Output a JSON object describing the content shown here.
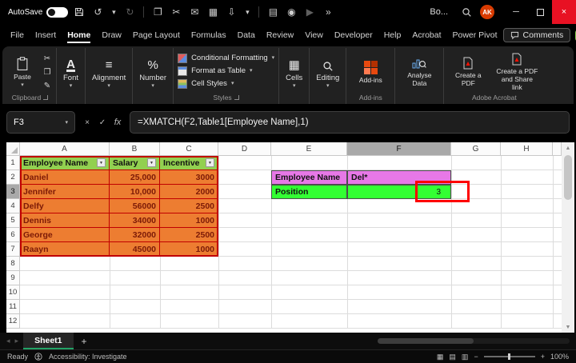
{
  "colors": {
    "accent_green": "#21a366",
    "table_header_fill": "#92d050",
    "table_body_fill": "#ed7d31",
    "table_border_red": "#c00000",
    "table_text_red": "#7c1a07",
    "lookup_magenta_fill": "#e778e7",
    "lookup_green_fill": "#33ff33",
    "annotation_red": "#fe0000",
    "close_button_red": "#e81123",
    "avatar_red": "#d83b01",
    "selected_header_gray": "#a9a9a9"
  },
  "title_bar": {
    "autosave_label": "AutoSave",
    "workbook_name": "Bo...",
    "avatar_initials": "AK"
  },
  "ribbon_tabs": {
    "items": [
      "File",
      "Insert",
      "Home",
      "Draw",
      "Page Layout",
      "Formulas",
      "Data",
      "Review",
      "View",
      "Developer",
      "Help",
      "Acrobat",
      "Power Pivot"
    ],
    "active": "Home",
    "comments_label": "Comments"
  },
  "ribbon": {
    "paste_label": "Paste",
    "clipboard_group_label": "Clipboard",
    "font_label": "Font",
    "alignment_label": "Alignment",
    "number_label": "Number",
    "conditional_formatting_label": "Conditional Formatting",
    "format_as_table_label": "Format as Table",
    "cell_styles_label": "Cell Styles",
    "styles_group_label": "Styles",
    "cells_label": "Cells",
    "editing_label": "Editing",
    "addins_label": "Add-ins",
    "addins_group_label": "Add-ins",
    "analyse_data_label": "Analyse Data",
    "create_pdf_label": "Create a PDF",
    "create_pdf_share_label": "Create a PDF and Share link",
    "adobe_group_label": "Adobe Acrobat"
  },
  "formula_bar": {
    "name_box_value": "F3",
    "cancel_label": "×",
    "enter_label": "✓",
    "fx_label": "fx",
    "formula": "=XMATCH(F2,Table1[Employee Name],1)"
  },
  "grid": {
    "column_headers": [
      "A",
      "B",
      "C",
      "D",
      "E",
      "F",
      "G",
      "H"
    ],
    "row_headers": [
      "1",
      "2",
      "3",
      "4",
      "5",
      "6",
      "7",
      "8",
      "9",
      "10",
      "11",
      "12"
    ],
    "selected_column": "F",
    "selected_row": "3",
    "employee_table": {
      "headers": [
        "Employee Name",
        "Salary",
        "Incentive"
      ],
      "rows": [
        [
          "Daniel",
          "25,000",
          "3000"
        ],
        [
          "Jennifer",
          "10,000",
          "2000"
        ],
        [
          "Delfy",
          "56000",
          "2500"
        ],
        [
          "Dennis",
          "34000",
          "1000"
        ],
        [
          "George",
          "32000",
          "2500"
        ],
        [
          "Raayn",
          "45000",
          "1000"
        ]
      ]
    },
    "lookup_cells": {
      "e2": "Employee Name",
      "f2": "Del*",
      "e3": "Position",
      "f3": "3"
    }
  },
  "sheet_bar": {
    "active_tab": "Sheet1",
    "add_sheet": "+"
  },
  "status_bar": {
    "mode": "Ready",
    "accessibility": "Accessibility: Investigate",
    "zoom": "100%"
  },
  "icons": {
    "undo": "↺",
    "redo": "↻",
    "copy": "❐",
    "cut": "✂",
    "mail": "✉",
    "grid": "▦",
    "download": "⇩",
    "chevron_down": "▾",
    "document": "▤",
    "camera": "◉",
    "play": "▶",
    "overflow": "»",
    "minimize": "─",
    "close": "×",
    "font_letter": "A",
    "alignment": "≡",
    "percent": "%",
    "cells": "▦",
    "pencil": "✎",
    "filter": "▼",
    "nav_left": "◂",
    "nav_right": "▸",
    "scroll_up": "▲",
    "scroll_down": "▼",
    "view_normal": "▦",
    "view_layout": "▤",
    "view_break": "▥",
    "zoom_out": "−",
    "zoom_in": "+"
  }
}
